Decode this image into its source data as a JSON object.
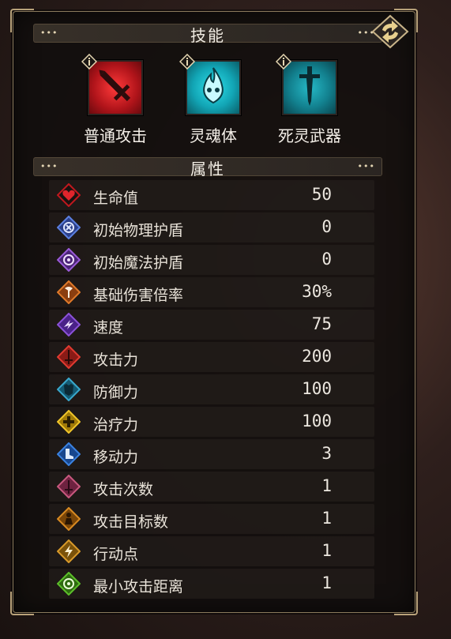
{
  "skills_section": {
    "title": "技能"
  },
  "skills": [
    {
      "name": "普通攻击",
      "icon": "sword-attack-icon",
      "color": "#c3161c"
    },
    {
      "name": "灵魂体",
      "icon": "soul-flame-icon",
      "color": "#17b2bf"
    },
    {
      "name": "死灵武器",
      "icon": "undead-sword-icon",
      "color": "#127a8a"
    }
  ],
  "attributes_section": {
    "title": "属性"
  },
  "attributes": [
    {
      "name": "生命值",
      "value": "50",
      "icon": "heart-icon",
      "color": "#c0181e"
    },
    {
      "name": "初始物理护盾",
      "value": "0",
      "icon": "physical-shield-icon",
      "color": "#4a6fd8"
    },
    {
      "name": "初始魔法护盾",
      "value": "0",
      "icon": "magic-shield-icon",
      "color": "#8a47c9"
    },
    {
      "name": "基础伤害倍率",
      "value": "30%",
      "icon": "axe-icon",
      "color": "#d76a22"
    },
    {
      "name": "速度",
      "value": "75",
      "icon": "speed-icon",
      "color": "#7b3fc6"
    },
    {
      "name": "攻击力",
      "value": "200",
      "icon": "attack-sword-icon",
      "color": "#d5322a"
    },
    {
      "name": "防御力",
      "value": "100",
      "icon": "armor-icon",
      "color": "#2a8fb0"
    },
    {
      "name": "治疗力",
      "value": "100",
      "icon": "heal-cross-icon",
      "color": "#e0b21b"
    },
    {
      "name": "移动力",
      "value": "3",
      "icon": "boot-icon",
      "color": "#2e6fd0"
    },
    {
      "name": "攻击次数",
      "value": "1",
      "icon": "attack-count-icon",
      "color": "#b8486a"
    },
    {
      "name": "攻击目标数",
      "value": "1",
      "icon": "target-count-icon",
      "color": "#c77a1d"
    },
    {
      "name": "行动点",
      "value": "1",
      "icon": "action-point-icon",
      "color": "#c78a1f"
    },
    {
      "name": "最小攻击距离",
      "value": "1",
      "icon": "range-target-icon",
      "color": "#4ea322"
    }
  ]
}
